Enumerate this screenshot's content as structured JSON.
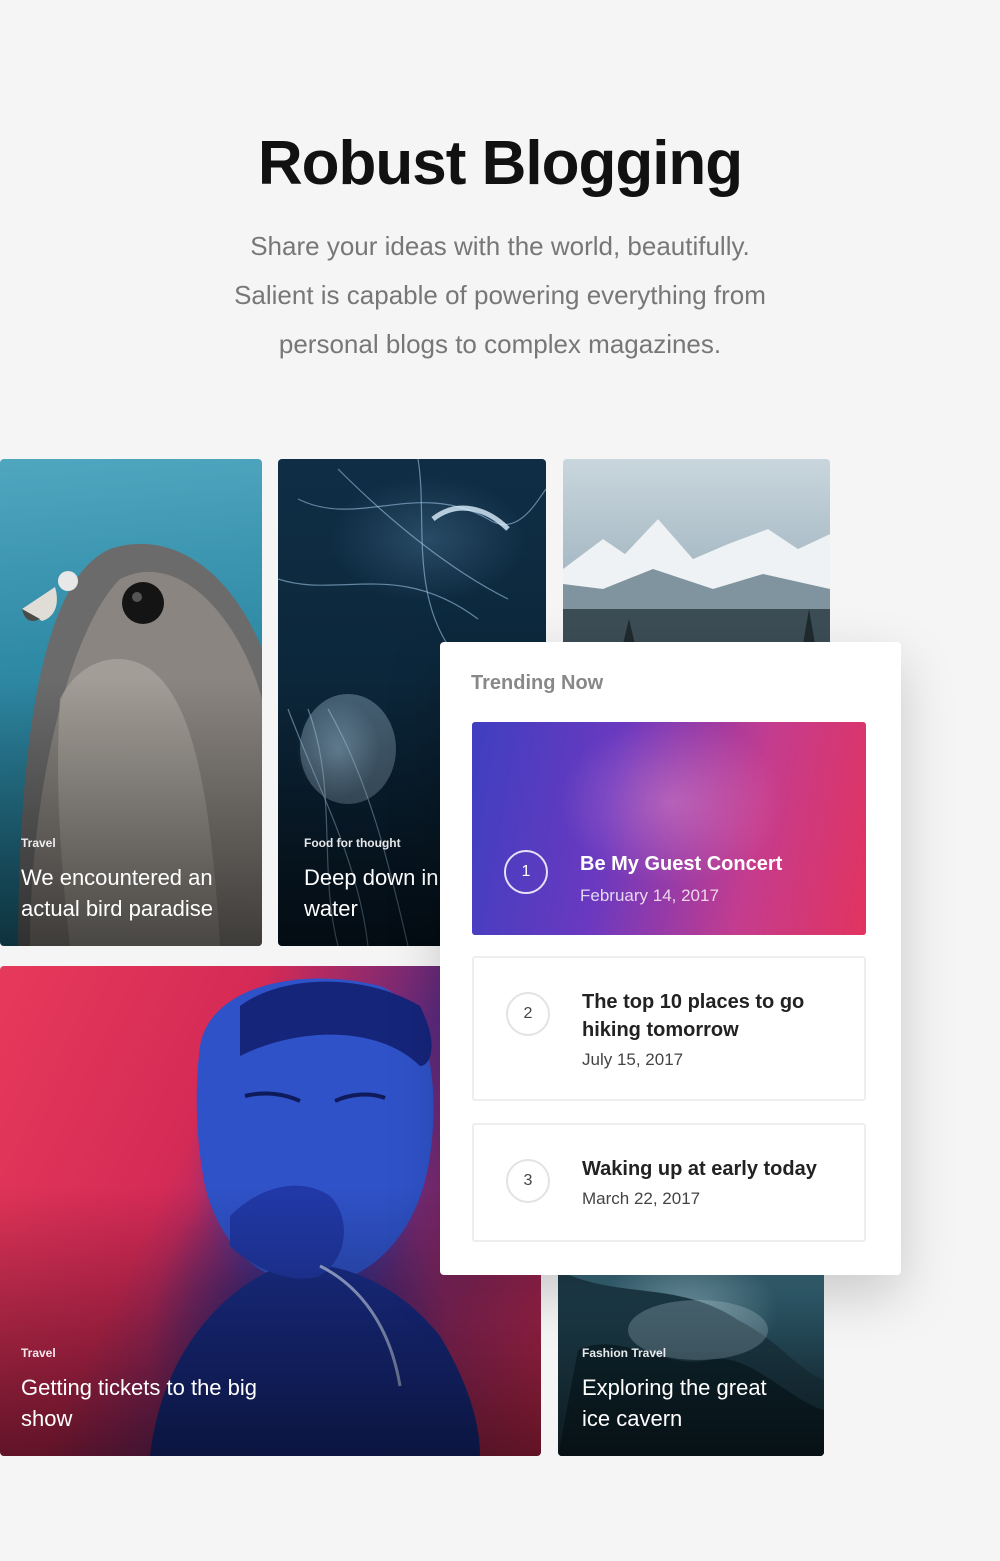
{
  "header": {
    "title": "Robust Blogging",
    "subtitle_lines": [
      "Share your ideas with the world, beautifully.",
      "Salient is capable of powering everything from",
      "personal blogs to complex magazines."
    ]
  },
  "cards": [
    {
      "category": "Travel",
      "title_lines": [
        "We encountered an",
        "actual bird paradise"
      ]
    },
    {
      "category": "Food for thought",
      "title_lines": [
        "Deep down in",
        "water"
      ]
    },
    {
      "category": "",
      "title_lines": []
    },
    {
      "category": "Travel",
      "title_lines": [
        "Getting tickets to the big",
        "show"
      ]
    },
    {
      "category": "Fashion  Travel",
      "title_lines": [
        "Exploring the great",
        "ice cavern"
      ]
    }
  ],
  "trending": {
    "heading": "Trending Now",
    "items": [
      {
        "number": "1",
        "title_lines": [
          "Be My Guest Concert"
        ],
        "date": "February 14, 2017"
      },
      {
        "number": "2",
        "title_lines": [
          "The top 10 places to go",
          "hiking tomorrow"
        ],
        "date": "July 15, 2017"
      },
      {
        "number": "3",
        "title_lines": [
          "Waking up at early today"
        ],
        "date": "March 22, 2017"
      }
    ]
  },
  "colors": {
    "background": "#f5f5f5",
    "headline": "#111111",
    "subtitle": "#777777",
    "trending_accent_start": "#3f3fc0",
    "trending_accent_end": "#e2335f"
  }
}
